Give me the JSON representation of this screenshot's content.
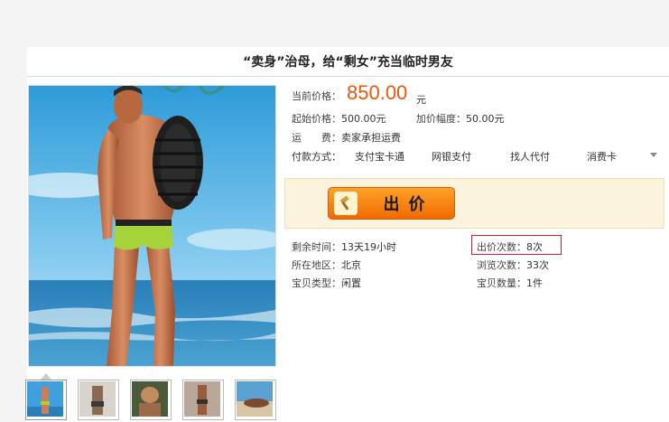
{
  "title": "“卖身”治母，给“剩女”充当临时男友",
  "price": {
    "label": "当前价格：",
    "value": "850.00",
    "unit": "元",
    "start_label": "起始价格：",
    "start_value": "500.00元",
    "increment_label": "加价幅度：",
    "increment_value": "50.00元"
  },
  "shipping": {
    "label": "运　　费：",
    "value": "卖家承担运费"
  },
  "payment": {
    "label": "付款方式：",
    "options": [
      "支付宝卡通",
      "网银支付",
      "找人代付",
      "消费卡"
    ]
  },
  "bid_button": {
    "label": "出价",
    "icon": "hammer-icon"
  },
  "details": {
    "remaining_label": "剩余时间：",
    "remaining_value": "13天19小时",
    "bids_label": "出价次数：",
    "bids_value": "8次",
    "location_label": "所在地区：",
    "location_value": "北京",
    "views_label": "浏览次数：",
    "views_value": "33次",
    "type_label": "宝贝类型：",
    "type_value": "闲置",
    "quantity_label": "宝贝数量：",
    "quantity_value": "1件"
  },
  "colors": {
    "price": "#e8570c",
    "bid_button": "#f68a0f",
    "bid_box": "#fbf3de",
    "highlight": "#cc2222"
  },
  "thumbnails": {
    "count": 5,
    "selected_index": 0
  }
}
